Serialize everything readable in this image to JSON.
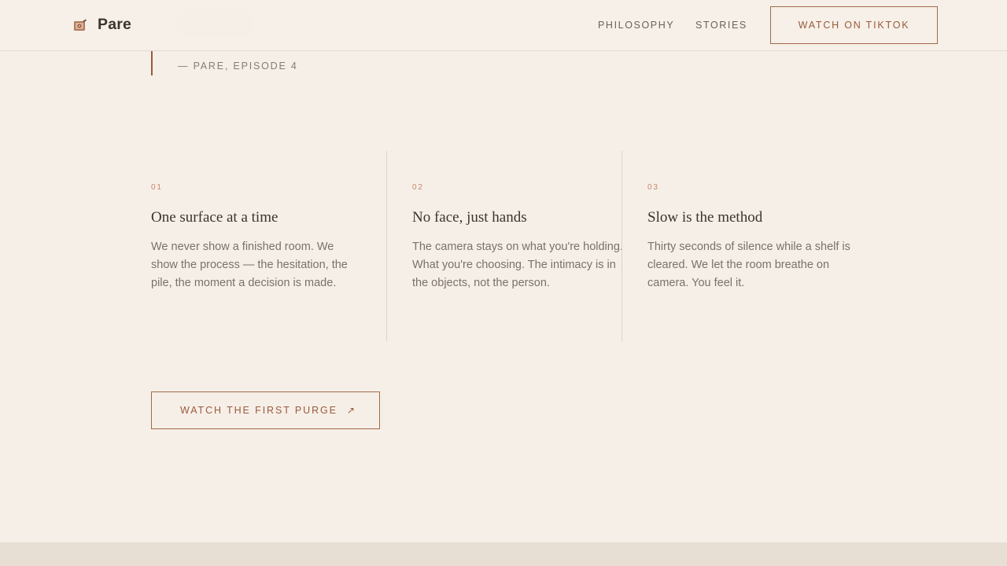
{
  "brand": {
    "name": "Pare",
    "icon": "box-icon"
  },
  "nav": {
    "philosophy": "PHILOSOPHY",
    "stories": "STORIES",
    "cta": "WATCH ON TIKTOK"
  },
  "quote": {
    "cite": "— PARE, EPISODE 4"
  },
  "pillars": [
    {
      "num": "01",
      "title": "One surface at a time",
      "body": "We never show a finished room. We show the process — the hesitation, the pile, the moment a decision is made."
    },
    {
      "num": "02",
      "title": "No face, just hands",
      "body": "The camera stays on what you're holding. What you're choosing. The intimacy is in the objects, not the person."
    },
    {
      "num": "03",
      "title": "Slow is the method",
      "body": "Thirty seconds of silence while a shelf is cleared. We let the room breathe on camera. You feel it."
    }
  ],
  "cta": {
    "label": "WATCH THE FIRST PURGE",
    "icon": "arrow-up-right-icon",
    "arrow": "↗"
  },
  "colors": {
    "background": "#f6efe8",
    "accent": "#9a5a3c",
    "number": "#c9876a",
    "footer": "#e7dfd4"
  }
}
